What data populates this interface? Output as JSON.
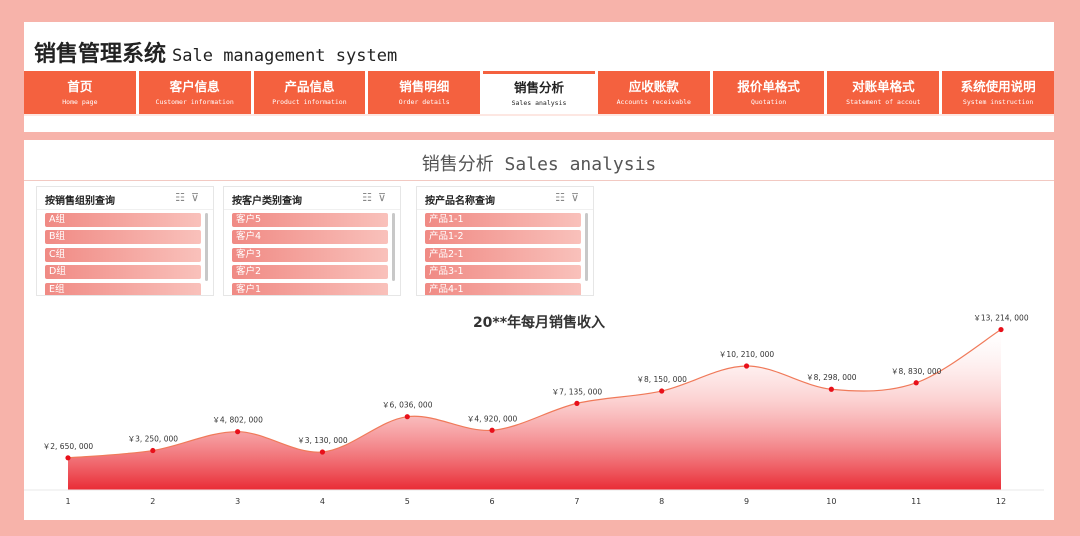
{
  "header": {
    "title_cn": "销售管理系统",
    "title_en": "Sale management system"
  },
  "tabs": [
    {
      "cn": "首页",
      "en": "Home page",
      "active": false
    },
    {
      "cn": "客户信息",
      "en": "Customer information",
      "active": false
    },
    {
      "cn": "产品信息",
      "en": "Product information",
      "active": false
    },
    {
      "cn": "销售明细",
      "en": "Order details",
      "active": false
    },
    {
      "cn": "销售分析",
      "en": "Sales analysis",
      "active": true
    },
    {
      "cn": "应收账款",
      "en": "Accounts receivable",
      "active": false
    },
    {
      "cn": "报价单格式",
      "en": "Quotation",
      "active": false
    },
    {
      "cn": "对账单格式",
      "en": "Statement of accout",
      "active": false
    },
    {
      "cn": "系统使用说明",
      "en": "System instruction",
      "active": false
    }
  ],
  "section": {
    "title": "销售分析 Sales analysis"
  },
  "slicers": [
    {
      "title": "按销售组别查询",
      "items": [
        "A组",
        "B组",
        "C组",
        "D组",
        "E组"
      ]
    },
    {
      "title": "按客户类别查询",
      "items": [
        "客户5",
        "客户4",
        "客户3",
        "客户2",
        "客户1"
      ]
    },
    {
      "title": "按产品名称查询",
      "items": [
        "产品1-1",
        "产品1-2",
        "产品2-1",
        "产品3-1",
        "产品4-1"
      ]
    }
  ],
  "colors": {
    "accent": "#f4613f",
    "line": "#f07a5a",
    "point": "#e8101a"
  },
  "chart_data": {
    "type": "area",
    "title": "20**年每月销售收入",
    "x": [
      1,
      2,
      3,
      4,
      5,
      6,
      7,
      8,
      9,
      10,
      11,
      12
    ],
    "values": [
      2650000,
      3250000,
      4802000,
      3130000,
      6036000,
      4920000,
      7135000,
      8150000,
      10210000,
      8298000,
      8830000,
      13214000
    ],
    "labels": [
      "￥2, 650, 000",
      "￥3, 250, 000",
      "￥4, 802, 000",
      "￥3, 130, 000",
      "￥6, 036, 000",
      "￥4, 920, 000",
      "￥7, 135, 000",
      "￥8, 150, 000",
      "￥10, 210, 000",
      "￥8, 298, 000",
      "￥8, 830, 000",
      "￥13, 214, 000"
    ],
    "xlabel": "",
    "ylabel": "",
    "ylim": [
      0,
      14000000
    ],
    "grid": false,
    "smooth": true
  }
}
